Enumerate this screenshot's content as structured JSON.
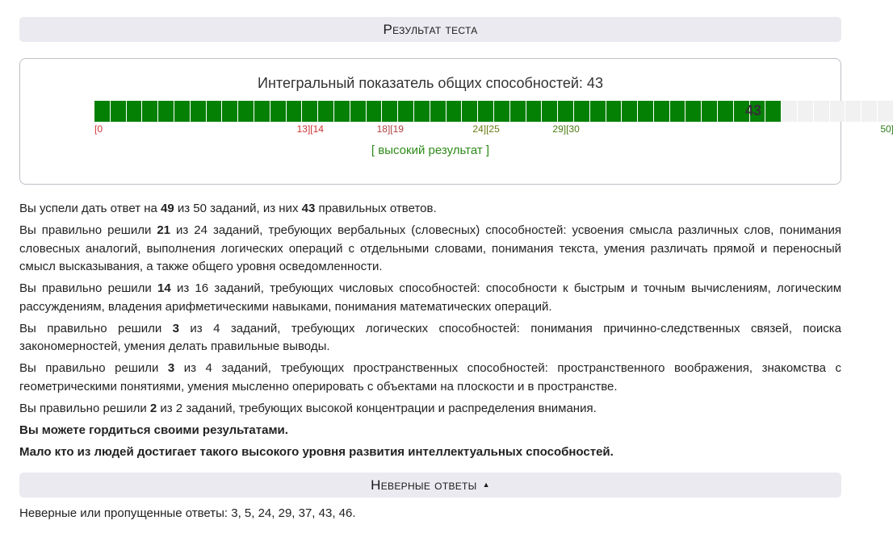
{
  "header": {
    "title": "Результат теста"
  },
  "score": {
    "title": "Интегральный показатель общих способностей: 43",
    "value": "43",
    "max": 50,
    "filled": 43,
    "fill_color": "#048004",
    "empty_color": "#f1f1f1",
    "ticks": [
      {
        "text": "[0",
        "color": "#cc3333",
        "at": 0
      },
      {
        "text": "13][14",
        "color": "#cc3333",
        "at": 13.5
      },
      {
        "text": "18][19",
        "color": "#b04040",
        "at": 18.5
      },
      {
        "text": "24][25",
        "color": "#6b7a10",
        "at": 24.5
      },
      {
        "text": "29][30",
        "color": "#4a7a10",
        "at": 29.5
      },
      {
        "text": "50]",
        "color": "#2e7d1a",
        "at": 50
      }
    ],
    "verdict": "[ высокий результат ]",
    "verdict_color": "#2e8b1a"
  },
  "summary": {
    "pre": "Вы успели дать ответ на ",
    "answered": "49",
    "mid": " из 50 заданий, из них ",
    "correct": "43",
    "post": " правильных ответов."
  },
  "categories": [
    {
      "pre": "Вы правильно решили ",
      "num": "21",
      "post": " из 24 заданий, требующих вербальных (словесных) способностей: усвоения смысла различных слов, понимания словесных аналогий, выполнения логических операций с отдельными словами, понимания текста, умения различать прямой и переносный смысл высказывания, а также общего уровня осведомленности."
    },
    {
      "pre": "Вы правильно решили ",
      "num": "14",
      "post": " из 16 заданий, требующих числовых способностей: способности к быстрым и точным вычислениям, логическим рассуждениям, владения арифметическими навыками, понимания математических операций."
    },
    {
      "pre": "Вы правильно решили ",
      "num": "3",
      "post": " из 4 заданий, требующих логических способностей: понимания причинно-следственных связей, поиска закономерностей, умения делать правильные выводы."
    },
    {
      "pre": "Вы правильно решили ",
      "num": "3",
      "post": " из 4 заданий, требующих пространственных способностей: пространственного воображения, знакомства с геометрическими понятиями, умения мысленно оперировать с объектами на плоскости и в пространстве."
    },
    {
      "pre": "Вы правильно решили ",
      "num": "2",
      "post": " из 2 заданий, требующих высокой концентрации и распределения внимания."
    }
  ],
  "conclusion": {
    "line1": "Вы можете гордиться своими результатами.",
    "line2": "Мало кто из людей достигает такого высокого уровня развития интеллектуальных способностей."
  },
  "wrong_section": {
    "title": "Неверные ответы",
    "arrow_icon": "triangle-up-icon",
    "arrow_glyph": "▲",
    "text": "Неверные или пропущенные ответы: 3, 5, 24, 29, 37, 43, 46."
  }
}
